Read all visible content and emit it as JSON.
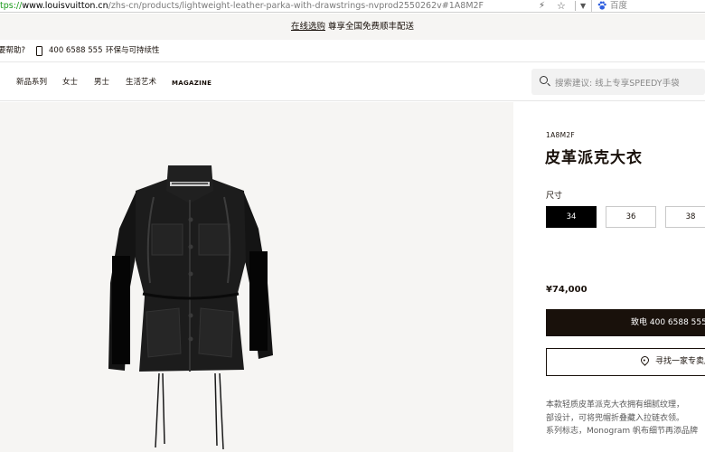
{
  "browser": {
    "url_protocol": "tps://",
    "url_host": "www.louisvuitton.cn",
    "url_path": "/zhs-cn/products/lightweight-leather-parka-with-drawstrings-nvprod2550262v#1A8M2F",
    "search_engine": "百度"
  },
  "promo": {
    "link": "在线选购",
    "text": " 尊享全国免费顺丰配送"
  },
  "utility": {
    "help": "要帮助?",
    "phone": "400 6588 555",
    "sustainability": "环保与可持续性"
  },
  "nav": {
    "items": [
      "新品系列",
      "女士",
      "男士",
      "生活艺术",
      "MAGAZINE"
    ],
    "search_placeholder": "搜索建议: 线上专享SPEEDY手袋"
  },
  "product": {
    "sku": "1A8M2F",
    "title": "皮革派克大衣",
    "size_label": "尺寸",
    "sizes": [
      "34",
      "36",
      "38"
    ],
    "selected_size": "34",
    "price": "¥74,000",
    "call_button": "致电 400 6588 555 咨",
    "store_button": "寻找一家专卖店",
    "description": [
      "本款轻质皮革派克大衣拥有细腻纹理，",
      "部设计，可将兜帽折叠藏入拉链衣领。",
      "系列标志，Monogram 帆布细节再添品牌"
    ]
  },
  "colors": {
    "brand_dark": "#19110b",
    "promo_bg": "#f6f5f3",
    "url_green": "#1a9a1a"
  }
}
